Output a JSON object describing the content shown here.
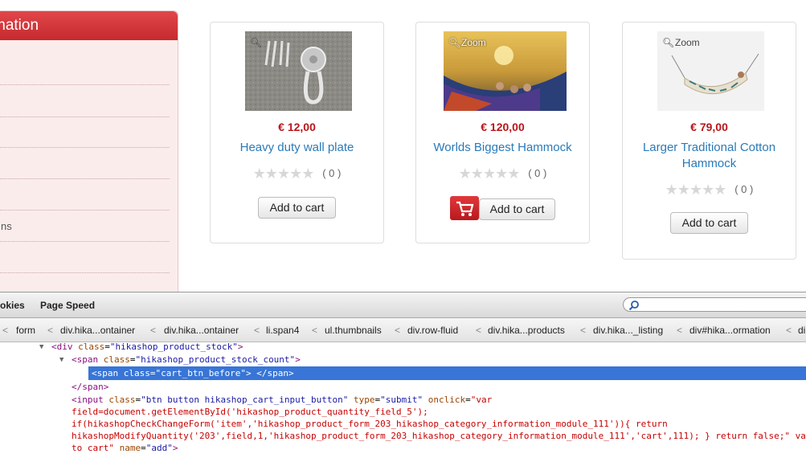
{
  "sidebar": {
    "title": "mation",
    "partial_item": "ns"
  },
  "products": [
    {
      "price": "€ 12,00",
      "name": "Heavy duty wall plate",
      "rating": "( 0 )",
      "button": "Add to cart",
      "zoom": ""
    },
    {
      "price": "€ 120,00",
      "name": "Worlds Biggest Hammock",
      "rating": "( 0 )",
      "button": "Add to cart",
      "zoom": "Zoom"
    },
    {
      "price": "€ 79,00",
      "name": "Larger Traditional Cotton Hammock",
      "rating": "( 0 )",
      "button": "Add to cart",
      "zoom": "Zoom"
    }
  ],
  "devtools": {
    "tabs": [
      "okies",
      "Page Speed"
    ],
    "breadcrumbs": [
      "form",
      "div.hika...ontainer",
      "div.hika...ontainer",
      "li.span4",
      "ul.thumbnails",
      "div.row-fluid",
      "div.hika...products",
      "div.hika..._listing",
      "div#hika...ormation",
      "di"
    ],
    "code": {
      "l1_tag": "div",
      "l1_attr": "class",
      "l1_val": "\"hikashop_product_stock\"",
      "l2_tag": "span",
      "l2_attr": "class",
      "l2_val": "\"hikashop_product_stock_count\"",
      "l3_text": "<span class=\"cart_btn_before\"> </span>",
      "l4_text": "</span>",
      "l5_tag": "input",
      "l5_a1": "class",
      "l5_v1": "\"btn button hikashop_cart_input_button\"",
      "l5_a2": "type",
      "l5_v2": "\"submit\"",
      "l5_a3": "onclick",
      "l5_v3": "\"var",
      "l6_text": "field=document.getElementById('hikashop_product_quantity_field_5');",
      "l7_text": "if(hikashopCheckChangeForm('item','hikashop_product_form_203_hikashop_category_information_module_111')){ return",
      "l8_text": "hikashopModifyQuantity('203',field,1,'hikashop_product_form_203_hikashop_category_information_module_111','cart',111); } return false;\" val",
      "l9_val": "to cart\"",
      "l9_attr": "name",
      "l9_v2": "\"add\""
    }
  },
  "colors": {
    "accent": "#c62a2e",
    "price": "#b8161b",
    "link": "#2a7ab8",
    "selection": "#3875d7"
  }
}
